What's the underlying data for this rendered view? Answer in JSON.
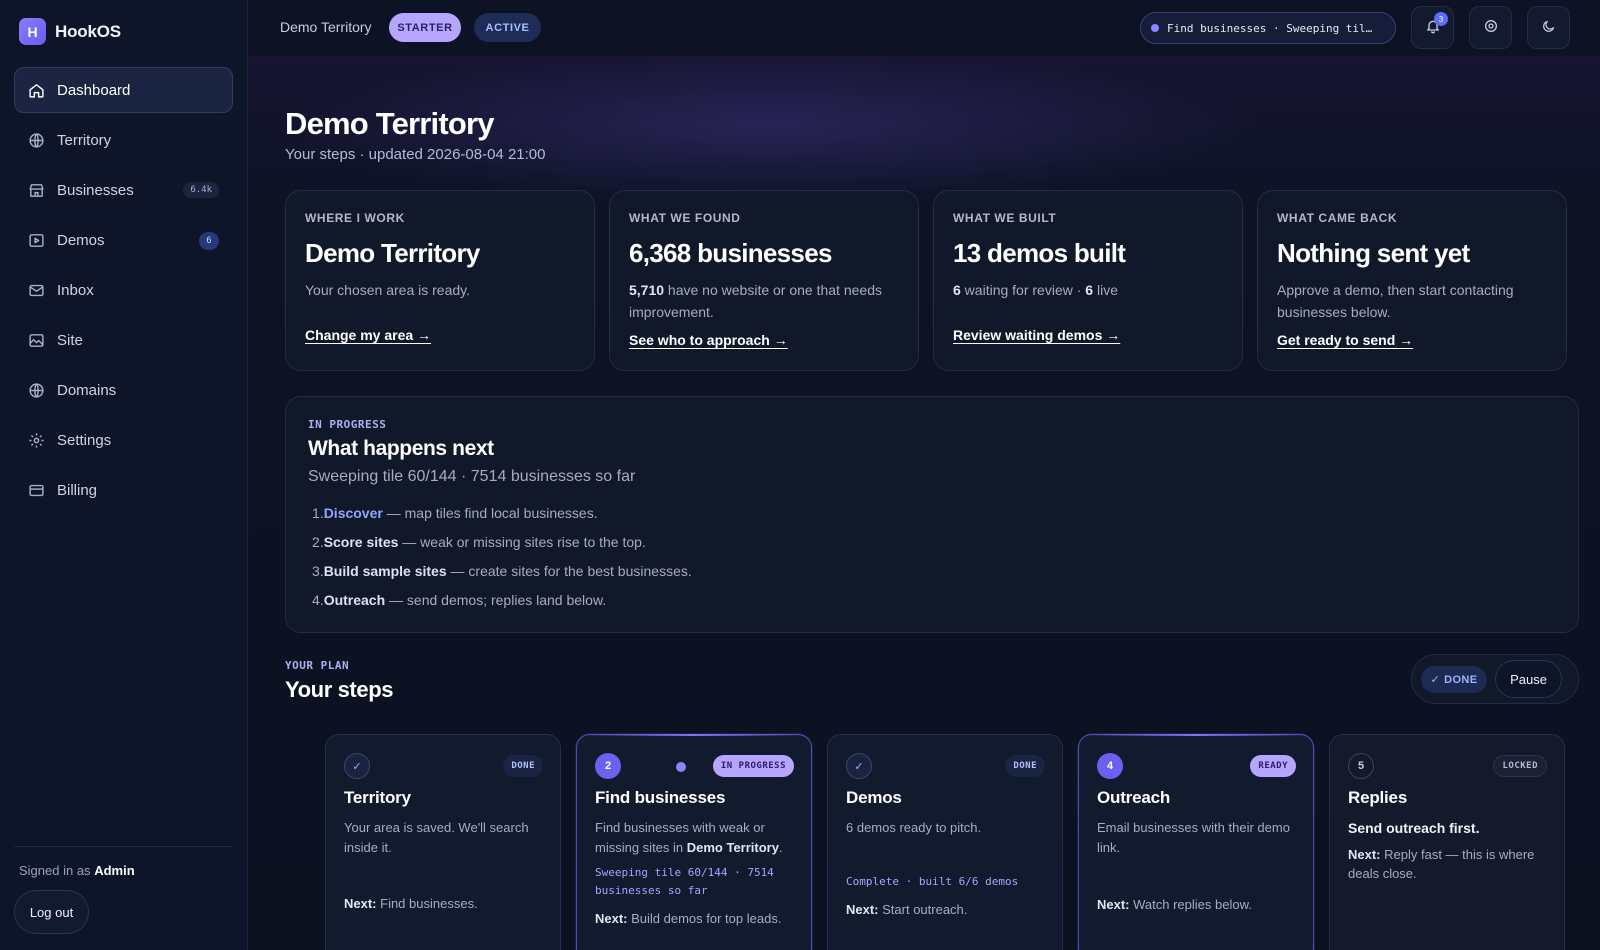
{
  "brand": {
    "logo_letter": "H",
    "name": "HookOS"
  },
  "sidebar": {
    "items": [
      {
        "label": "Dashboard",
        "icon": "home-icon",
        "active": true,
        "badge": ""
      },
      {
        "label": "Territory",
        "icon": "globe-icon",
        "active": false,
        "badge": ""
      },
      {
        "label": "Businesses",
        "icon": "store-icon",
        "active": false,
        "badge": "6.4k"
      },
      {
        "label": "Demos",
        "icon": "play-square-icon",
        "active": false,
        "badge": "6"
      },
      {
        "label": "Inbox",
        "icon": "mail-icon",
        "active": false,
        "badge": ""
      },
      {
        "label": "Site",
        "icon": "image-icon",
        "active": false,
        "badge": ""
      },
      {
        "label": "Domains",
        "icon": "globe-icon",
        "active": false,
        "badge": ""
      },
      {
        "label": "Settings",
        "icon": "gear-icon",
        "active": false,
        "badge": ""
      },
      {
        "label": "Billing",
        "icon": "card-icon",
        "active": false,
        "badge": ""
      }
    ],
    "signed_in_prefix": "Signed in as",
    "signed_in_user": "Admin",
    "logout_label": "Log out"
  },
  "topbar": {
    "crumb": "Demo Territory",
    "plan_pill": "STARTER",
    "status_pill": "ACTIVE",
    "job_status": "Find businesses · Sweeping til…",
    "notification_count": "3"
  },
  "header": {
    "title": "Demo Territory",
    "subtitle": "Your steps · updated 2026-08-04 21:00"
  },
  "stats": [
    {
      "label": "WHERE I WORK",
      "value": "Demo Territory",
      "desc_parts": [
        "Your chosen area is ready."
      ],
      "link": "Change my area →"
    },
    {
      "label": "WHAT WE FOUND",
      "value": "6,368 businesses",
      "desc_bold": "5,710",
      "desc_rest": " have no website or one that needs improvement.",
      "link": "See who to approach →"
    },
    {
      "label": "WHAT WE BUILT",
      "value": "13 demos built",
      "desc_bold_1": "6",
      "desc_mid": " waiting for review · ",
      "desc_bold_2": "6",
      "desc_end": " live",
      "link": "Review waiting demos →"
    },
    {
      "label": "WHAT CAME BACK",
      "value": "Nothing sent yet",
      "desc": "Approve a demo, then start contacting businesses below.",
      "link": "Get ready to send →"
    }
  ],
  "progress": {
    "label": "IN PROGRESS",
    "title": "What happens next",
    "subtitle": "Sweeping tile 60/144 · 7514 businesses so far",
    "steps": [
      {
        "num": "1.",
        "name": "Discover",
        "desc": " — map tiles find local businesses."
      },
      {
        "num": "2.",
        "name": "Score sites",
        "desc": " — weak or missing sites rise to the top."
      },
      {
        "num": "3.",
        "name": "Build sample sites",
        "desc": " — create sites for the best businesses."
      },
      {
        "num": "4.",
        "name": "Outreach",
        "desc": " — send demos; replies land below."
      }
    ]
  },
  "plan": {
    "label": "YOUR PLAN",
    "title": "Your steps",
    "done_label": "DONE",
    "pause_label": "Pause"
  },
  "step_cards": [
    {
      "num": "✓",
      "status": "DONE",
      "title": "Territory",
      "desc": "Your area is saved. We'll search inside it.",
      "next_label": "Next:",
      "next": " Find businesses."
    },
    {
      "num": "2",
      "status": "IN PROGRESS",
      "title": "Find businesses",
      "desc_start": "Find businesses with weak or missing sites in ",
      "desc_bold": "Demo Territory",
      "desc_end": ".",
      "mono": "Sweeping tile 60/144 · 7514 businesses so far",
      "next_label": "Next:",
      "next": " Build demos for top leads."
    },
    {
      "num": "✓",
      "status": "DONE",
      "title": "Demos",
      "desc": "6 demos ready to pitch.",
      "mono": "Complete · built 6/6 demos",
      "next_label": "Next:",
      "next": " Start outreach."
    },
    {
      "num": "4",
      "status": "READY",
      "title": "Outreach",
      "desc": "Email businesses with their demo link.",
      "next_label": "Next:",
      "next": " Watch replies below."
    },
    {
      "num": "5",
      "status": "LOCKED",
      "title": "Replies",
      "desc": "Send outreach first.",
      "next_label": "Next:",
      "next": " Reply fast — this is where deals close."
    }
  ]
}
